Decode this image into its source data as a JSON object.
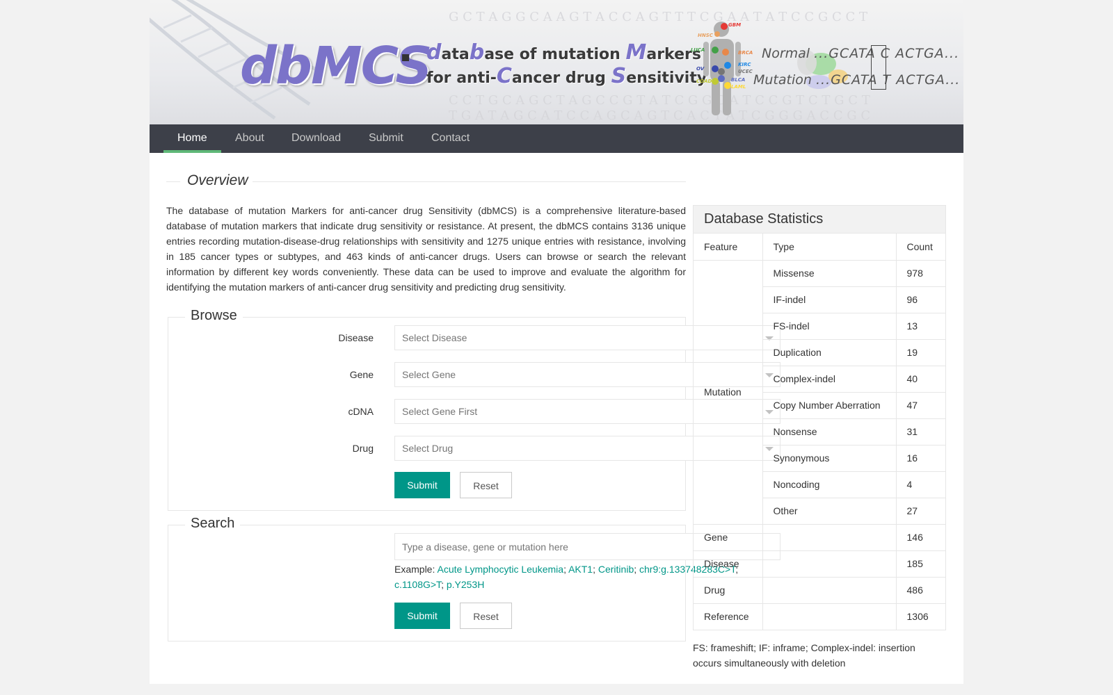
{
  "banner": {
    "logo": "dbMCS",
    "tagline_line1": [
      {
        "t": "d",
        "cap": true
      },
      {
        "t": "ata",
        "cap": false
      },
      {
        "t": "b",
        "cap": true
      },
      {
        "t": "ase of mutation ",
        "cap": false
      },
      {
        "t": "M",
        "cap": true
      },
      {
        "t": "arkers",
        "cap": false
      }
    ],
    "tagline_line2": [
      {
        "t": "for anti-",
        "cap": false
      },
      {
        "t": "C",
        "cap": true
      },
      {
        "t": "ancer drug ",
        "cap": false
      },
      {
        "t": "S",
        "cap": true
      },
      {
        "t": "ensitivity",
        "cap": false
      }
    ],
    "normal_label": "Normal",
    "normal_seq": "...GCATA C ACTGA...",
    "mutation_label": "Mutation",
    "mutation_seq": "...GCATA T ACTGA...",
    "body_labels": [
      "GBM",
      "HNSC",
      "BRCA",
      "LUCA",
      "OV",
      "KIRC",
      "UCEC",
      "COAD",
      "BLCA",
      "LAML"
    ]
  },
  "nav": [
    {
      "label": "Home",
      "active": true
    },
    {
      "label": "About",
      "active": false
    },
    {
      "label": "Download",
      "active": false
    },
    {
      "label": "Submit",
      "active": false
    },
    {
      "label": "Contact",
      "active": false
    }
  ],
  "overview": {
    "title": "Overview",
    "text": "The database of mutation Markers for anti-cancer drug Sensitivity (dbMCS) is a comprehensive literature-based database of mutation markers that indicate drug sensitivity or resistance. At present, the dbMCS contains 3136 unique entries recording mutation-disease-drug relationships with sensitivity and 1275 unique entries with resistance, involving in 185 cancer types or subtypes, and 463 kinds of anti-cancer drugs. Users can browse or search the relevant information by different key words conveniently. These data can be used to improve and evaluate the algorithm for identifying the mutation markers of anti-cancer drug sensitivity and predicting drug sensitivity."
  },
  "browse": {
    "title": "Browse",
    "fields": [
      {
        "label": "Disease",
        "placeholder": "Select Disease"
      },
      {
        "label": "Gene",
        "placeholder": "Select Gene"
      },
      {
        "label": "cDNA",
        "placeholder": "Select Gene First"
      },
      {
        "label": "Drug",
        "placeholder": "Select Drug"
      }
    ],
    "submit_label": "Submit",
    "reset_label": "Reset"
  },
  "search": {
    "title": "Search",
    "placeholder": "Type a disease, gene or mutation here",
    "example_label": "Example:",
    "examples": [
      "Acute Lymphocytic Leukemia",
      "AKT1",
      "Ceritinib",
      "chr9:g.133748283C>T",
      "c.1108G>T",
      "p.Y253H"
    ],
    "submit_label": "Submit",
    "reset_label": "Reset"
  },
  "stats": {
    "title": "Database Statistics",
    "headers": [
      "Feature",
      "Type",
      "Count"
    ],
    "mutation_label": "Mutation",
    "mutation_rows": [
      {
        "type": "Missense",
        "count": "978"
      },
      {
        "type": "IF-indel",
        "count": "96"
      },
      {
        "type": "FS-indel",
        "count": "13"
      },
      {
        "type": "Duplication",
        "count": "19"
      },
      {
        "type": "Complex-indel",
        "count": "40"
      },
      {
        "type": "Copy Number Aberration",
        "count": "47"
      },
      {
        "type": "Nonsense",
        "count": "31"
      },
      {
        "type": "Synonymous",
        "count": "16"
      },
      {
        "type": "Noncoding",
        "count": "4"
      },
      {
        "type": "Other",
        "count": "27"
      }
    ],
    "other_rows": [
      {
        "feature": "Gene",
        "count": "146"
      },
      {
        "feature": "Disease",
        "count": "185"
      },
      {
        "feature": "Drug",
        "count": "486"
      },
      {
        "feature": "Reference",
        "count": "1306"
      }
    ],
    "footnote": "FS: frameshift; IF: inframe; Complex-indel: insertion occurs simultaneously with deletion"
  },
  "colors": {
    "primary": "#009688",
    "nav_bg": "#3d4049",
    "nav_active": "#5fb878",
    "logo": "#7b73c9"
  }
}
